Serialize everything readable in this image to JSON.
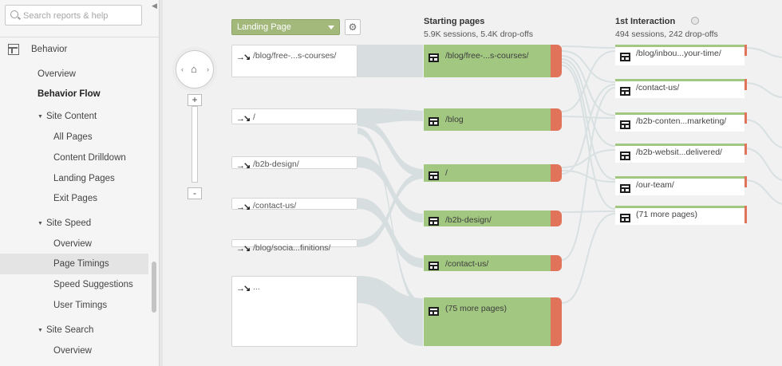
{
  "sidebar": {
    "search_placeholder": "Search reports & help",
    "behavior_label": "Behavior",
    "items": [
      {
        "label": "Overview"
      },
      {
        "label": "Behavior Flow"
      },
      {
        "label": "Site Content"
      },
      {
        "label": "All Pages"
      },
      {
        "label": "Content Drilldown"
      },
      {
        "label": "Landing Pages"
      },
      {
        "label": "Exit Pages"
      },
      {
        "label": "Site Speed"
      },
      {
        "label": "Overview"
      },
      {
        "label": "Page Timings"
      },
      {
        "label": "Speed Suggestions"
      },
      {
        "label": "User Timings"
      },
      {
        "label": "Site Search"
      },
      {
        "label": "Overview"
      }
    ]
  },
  "flow": {
    "dimension_selector": "Landing Page",
    "nav_icons": {
      "home": "home-icon",
      "left": "left-arrow-icon",
      "right": "right-arrow-icon"
    },
    "zoom": {
      "plus": "+",
      "minus": "-"
    },
    "landing_pages": [
      {
        "label": "/blog/free-...s-courses/"
      },
      {
        "label": "/"
      },
      {
        "label": "/b2b-design/"
      },
      {
        "label": "/contact-us/"
      },
      {
        "label": "/blog/socia...finitions/"
      },
      {
        "label": "..."
      }
    ],
    "starting_pages": {
      "title": "Starting pages",
      "subtitle": "5.9K sessions, 5.4K drop-offs",
      "nodes": [
        {
          "label": "/blog/free-...s-courses/"
        },
        {
          "label": "/blog"
        },
        {
          "label": "/"
        },
        {
          "label": "/b2b-design/"
        },
        {
          "label": "/contact-us/"
        },
        {
          "label": "(75 more pages)"
        }
      ]
    },
    "first_interaction": {
      "title": "1st Interaction",
      "subtitle": "494 sessions, 242 drop-offs",
      "nodes": [
        {
          "label": "/blog/inbou...your-time/"
        },
        {
          "label": "/contact-us/"
        },
        {
          "label": "/b2b-conten...marketing/"
        },
        {
          "label": "/b2b-websit...delivered/"
        },
        {
          "label": "/our-team/"
        },
        {
          "label": "(71 more pages)"
        }
      ]
    },
    "colors": {
      "node_green": "#a2c781",
      "dropoff_red": "#e2735b",
      "flow_gray": "#d5dcde",
      "dropdown_green": "#a3b97c"
    }
  }
}
